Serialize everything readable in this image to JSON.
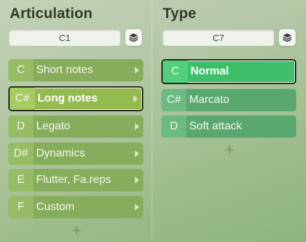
{
  "articulation": {
    "title": "Articulation",
    "note_value": "C1",
    "items": [
      {
        "key": "C",
        "label": "Short notes",
        "selected": false
      },
      {
        "key": "C#",
        "label": "Long notes",
        "selected": true
      },
      {
        "key": "D",
        "label": "Legato",
        "selected": false
      },
      {
        "key": "D#",
        "label": "Dynamics",
        "selected": false
      },
      {
        "key": "E",
        "label": "Flutter, Fa.reps",
        "selected": false
      },
      {
        "key": "F",
        "label": "Custom",
        "selected": false
      }
    ],
    "add_label": "+"
  },
  "type": {
    "title": "Type",
    "note_value": "C7",
    "items": [
      {
        "key": "C",
        "label": "Normal",
        "selected": true
      },
      {
        "key": "C#",
        "label": "Marcato",
        "selected": false
      },
      {
        "key": "D",
        "label": "Soft attack",
        "selected": false
      }
    ],
    "add_label": "+"
  },
  "icons": {
    "layers": "layers-icon",
    "chevron": "chevron-right-icon",
    "add": "plus-icon"
  },
  "colors": {
    "articulation_row": "#86ad5b",
    "type_row": "#5aa870",
    "type_selected": "#3fbf6a"
  }
}
